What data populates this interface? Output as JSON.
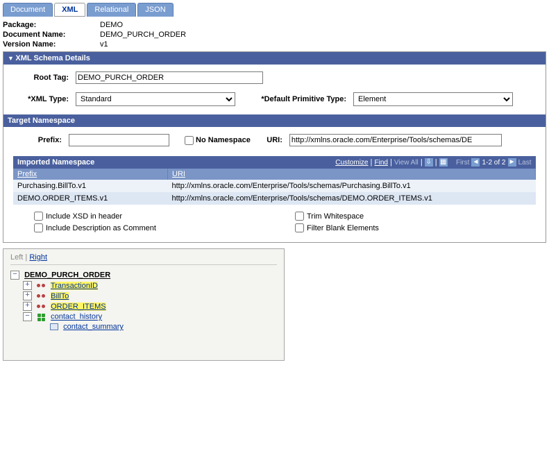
{
  "tabs": [
    "Document",
    "XML",
    "Relational",
    "JSON"
  ],
  "active_tab": "XML",
  "meta": {
    "package_label": "Package:",
    "package_value": "DEMO",
    "docname_label": "Document Name:",
    "docname_value": "DEMO_PURCH_ORDER",
    "version_label": "Version Name:",
    "version_value": "v1"
  },
  "schema": {
    "header": "XML Schema Details",
    "root_tag_label": "Root Tag:",
    "root_tag_value": "DEMO_PURCH_ORDER",
    "xml_type_label": "*XML Type:",
    "xml_type_value": "Standard",
    "default_prim_label": "*Default Primitive Type:",
    "default_prim_value": "Element"
  },
  "target_ns": {
    "header": "Target Namespace",
    "prefix_label": "Prefix:",
    "prefix_value": "",
    "no_ns_label": "No Namespace",
    "uri_label": "URI:",
    "uri_value": "http://xmlns.oracle.com/Enterprise/Tools/schemas/DE"
  },
  "imported": {
    "title": "Imported Namespace",
    "customize": "Customize",
    "find": "Find",
    "viewall": "View All",
    "first": "First",
    "range": "1-2 of 2",
    "last": "Last",
    "col_prefix": "Prefix",
    "col_uri": "URI",
    "rows": [
      {
        "prefix": "Purchasing.BillTo.v1",
        "uri": "http://xmlns.oracle.com/Enterprise/Tools/schemas/Purchasing.BillTo.v1"
      },
      {
        "prefix": "DEMO.ORDER_ITEMS.v1",
        "uri": "http://xmlns.oracle.com/Enterprise/Tools/schemas/DEMO.ORDER_ITEMS.v1"
      }
    ]
  },
  "options": {
    "include_xsd": "Include XSD in header",
    "include_desc": "Include Description as Comment",
    "trim_ws": "Trim Whitespace",
    "filter_blank": "Filter Blank Elements"
  },
  "tree": {
    "left": "Left",
    "right": "Right",
    "root": "DEMO_PURCH_ORDER",
    "nodes": {
      "transaction_id": "TransactionID",
      "billto": "BillTo",
      "order_items": "ORDER_ITEMS",
      "contact_history": "contact_history",
      "contact_summary": "contact_summary"
    }
  }
}
